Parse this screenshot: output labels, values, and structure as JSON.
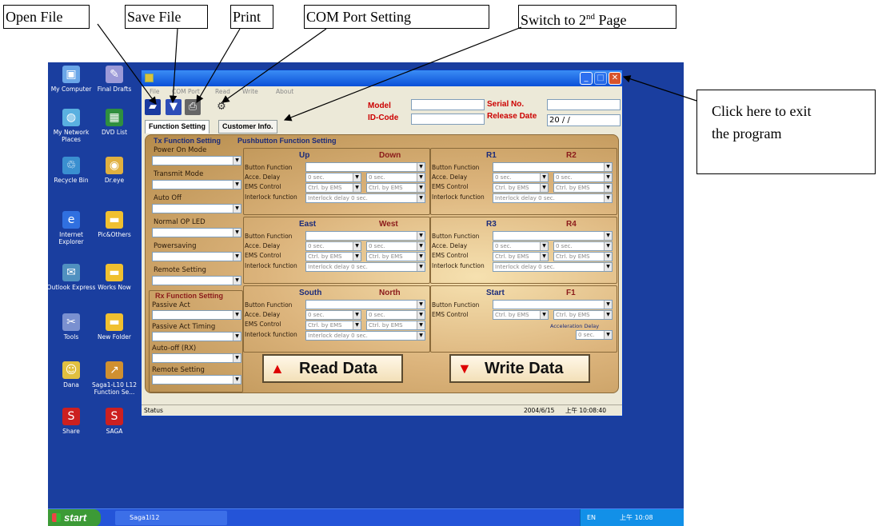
{
  "annotations": {
    "open_file": "Open File",
    "save_file": "Save File",
    "print": "Print",
    "com_port": "COM Port Setting",
    "switch_page_prefix": "Switch to 2",
    "switch_page_sup": "nd",
    "switch_page_suffix": " Page",
    "exit_line1": "Click here to exit",
    "exit_line2": "the program"
  },
  "desktop_icons": [
    {
      "label": "My Computer",
      "icon": "computer-icon"
    },
    {
      "label": "Final Drafts",
      "icon": "document-icon"
    },
    {
      "label": "My Network Places",
      "icon": "network-icon"
    },
    {
      "label": "DVD List",
      "icon": "spreadsheet-icon"
    },
    {
      "label": "Recycle Bin",
      "icon": "recycle-bin-icon"
    },
    {
      "label": "Dr.eye",
      "icon": "app-icon"
    },
    {
      "label": "Internet Explorer",
      "icon": "ie-icon"
    },
    {
      "label": "Pic&Others",
      "icon": "folder-icon"
    },
    {
      "label": "Outlook Express",
      "icon": "mail-icon"
    },
    {
      "label": "Works Now",
      "icon": "folder-icon"
    },
    {
      "label": "Tools",
      "icon": "tools-icon"
    },
    {
      "label": "New Folder",
      "icon": "folder-icon"
    },
    {
      "label": "Dana",
      "icon": "user-icon"
    },
    {
      "label": "Saga1-L10 L12 Function Se...",
      "icon": "shortcut-icon"
    },
    {
      "label": "Share",
      "icon": "saga-icon"
    },
    {
      "label": "SAGA",
      "icon": "saga-icon"
    }
  ],
  "taskbar": {
    "start": "start",
    "app": "Saga1l12",
    "lang": "EN",
    "time": "上午 10:08"
  },
  "menu": [
    "File",
    "COM Port",
    "Read",
    "Write",
    "About"
  ],
  "header": {
    "model_label": "Model",
    "id_label": "ID-Code",
    "serial_label": "Serial No.",
    "release_label": "Release Date",
    "release_value": "20   /   /"
  },
  "tabs": {
    "function": "Function Setting",
    "customer": "Customer Info."
  },
  "tx": {
    "title": "Tx Function Setting",
    "items": [
      "Power On Mode",
      "Transmit Mode",
      "Auto Off",
      "Normal OP LED",
      "Powersaving",
      "Remote Setting"
    ]
  },
  "rx": {
    "title": "Rx Function Setting",
    "items": [
      "Passive Act",
      "Passive Act Timing",
      "Auto-off (RX)",
      "Remote Setting"
    ]
  },
  "pb_title": "Pushbutton Function Setting",
  "row_labels": {
    "button": "Button Function",
    "acce": "Acce.  Delay",
    "ems": "EMS Control",
    "interlock": "Interlock function"
  },
  "combo_text": {
    "sec_left": "0    sec.",
    "sec_right": "0    sec.",
    "ems": "Ctrl. by EMS",
    "interlock": "Interlock  delay  0    sec."
  },
  "sections": [
    {
      "left": "Up",
      "right": "Down"
    },
    {
      "left": "R1",
      "right": "R2"
    },
    {
      "left": "East",
      "right": "West"
    },
    {
      "left": "R3",
      "right": "R4"
    },
    {
      "left": "South",
      "right": "North"
    },
    {
      "left": "Start",
      "right": "F1"
    }
  ],
  "accel_delay": {
    "label": "Acceleration Delay",
    "value": "0    sec."
  },
  "buttons": {
    "read": "Read Data",
    "write": "Write Data"
  },
  "status": {
    "text": "Status",
    "date": "2004/6/15",
    "time": "上午 10:08:40"
  }
}
